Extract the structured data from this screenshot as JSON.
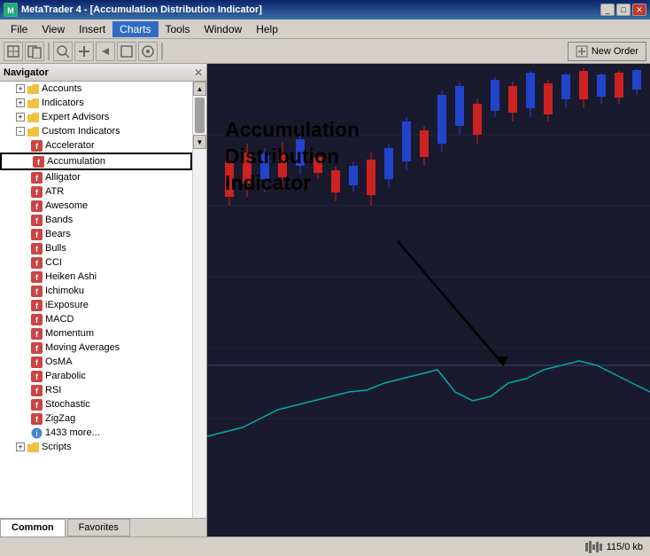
{
  "window": {
    "title": "MetaTrader 4 - [Accumulation Distribution Indicator]",
    "title_icon": "MT",
    "btns": [
      "_",
      "□",
      "✕"
    ]
  },
  "menu": {
    "items": [
      "File",
      "View",
      "Insert",
      "Charts",
      "Tools",
      "Window",
      "Help"
    ]
  },
  "toolbar": {
    "buttons": [
      "⊕",
      "◧",
      "↕",
      "✛",
      "→",
      "▣",
      "◉"
    ],
    "new_order": "New Order"
  },
  "navigator": {
    "title": "Navigator",
    "close": "✕",
    "tree": [
      {
        "id": "accounts",
        "label": "Accounts",
        "indent": 1,
        "type": "folder",
        "state": "collapsed"
      },
      {
        "id": "indicators",
        "label": "Indicators",
        "indent": 1,
        "type": "folder",
        "state": "collapsed"
      },
      {
        "id": "expert-advisors",
        "label": "Expert Advisors",
        "indent": 1,
        "type": "folder",
        "state": "collapsed"
      },
      {
        "id": "custom-indicators",
        "label": "Custom Indicators",
        "indent": 1,
        "type": "folder",
        "state": "expanded"
      },
      {
        "id": "accelerator",
        "label": "Accelerator",
        "indent": 2,
        "type": "indicator"
      },
      {
        "id": "accumulation",
        "label": "Accumulation",
        "indent": 2,
        "type": "indicator",
        "selected": true
      },
      {
        "id": "alligator",
        "label": "Alligator",
        "indent": 2,
        "type": "indicator"
      },
      {
        "id": "atr",
        "label": "ATR",
        "indent": 2,
        "type": "indicator"
      },
      {
        "id": "awesome",
        "label": "Awesome",
        "indent": 2,
        "type": "indicator"
      },
      {
        "id": "bands",
        "label": "Bands",
        "indent": 2,
        "type": "indicator"
      },
      {
        "id": "bears",
        "label": "Bears",
        "indent": 2,
        "type": "indicator"
      },
      {
        "id": "bulls",
        "label": "Bulls",
        "indent": 2,
        "type": "indicator"
      },
      {
        "id": "cci",
        "label": "CCI",
        "indent": 2,
        "type": "indicator"
      },
      {
        "id": "heiken-ashi",
        "label": "Heiken Ashi",
        "indent": 2,
        "type": "indicator"
      },
      {
        "id": "ichimoku",
        "label": "Ichimoku",
        "indent": 2,
        "type": "indicator"
      },
      {
        "id": "iexposure",
        "label": "iExposure",
        "indent": 2,
        "type": "indicator"
      },
      {
        "id": "macd",
        "label": "MACD",
        "indent": 2,
        "type": "indicator"
      },
      {
        "id": "momentum",
        "label": "Momentum",
        "indent": 2,
        "type": "indicator"
      },
      {
        "id": "moving-averages",
        "label": "Moving Averages",
        "indent": 2,
        "type": "indicator"
      },
      {
        "id": "osma",
        "label": "OsMA",
        "indent": 2,
        "type": "indicator"
      },
      {
        "id": "parabolic",
        "label": "Parabolic",
        "indent": 2,
        "type": "indicator"
      },
      {
        "id": "rsi",
        "label": "RSI",
        "indent": 2,
        "type": "indicator"
      },
      {
        "id": "stochastic",
        "label": "Stochastic",
        "indent": 2,
        "type": "indicator"
      },
      {
        "id": "zigzag",
        "label": "ZigZag",
        "indent": 2,
        "type": "indicator"
      },
      {
        "id": "more",
        "label": "1433 more...",
        "indent": 2,
        "type": "more"
      },
      {
        "id": "scripts",
        "label": "Scripts",
        "indent": 1,
        "type": "folder",
        "state": "collapsed"
      }
    ],
    "tabs": [
      "Common",
      "Favorites"
    ]
  },
  "annotation": {
    "lines": [
      "Accumulation",
      "Distribution",
      "Indicator"
    ]
  },
  "status": {
    "memory": "115/0 kb"
  },
  "chart": {
    "bg_color": "#1a1a2e",
    "candles": "bullish/bearish candlestick data",
    "indicator_line_color": "#00aaaa"
  }
}
